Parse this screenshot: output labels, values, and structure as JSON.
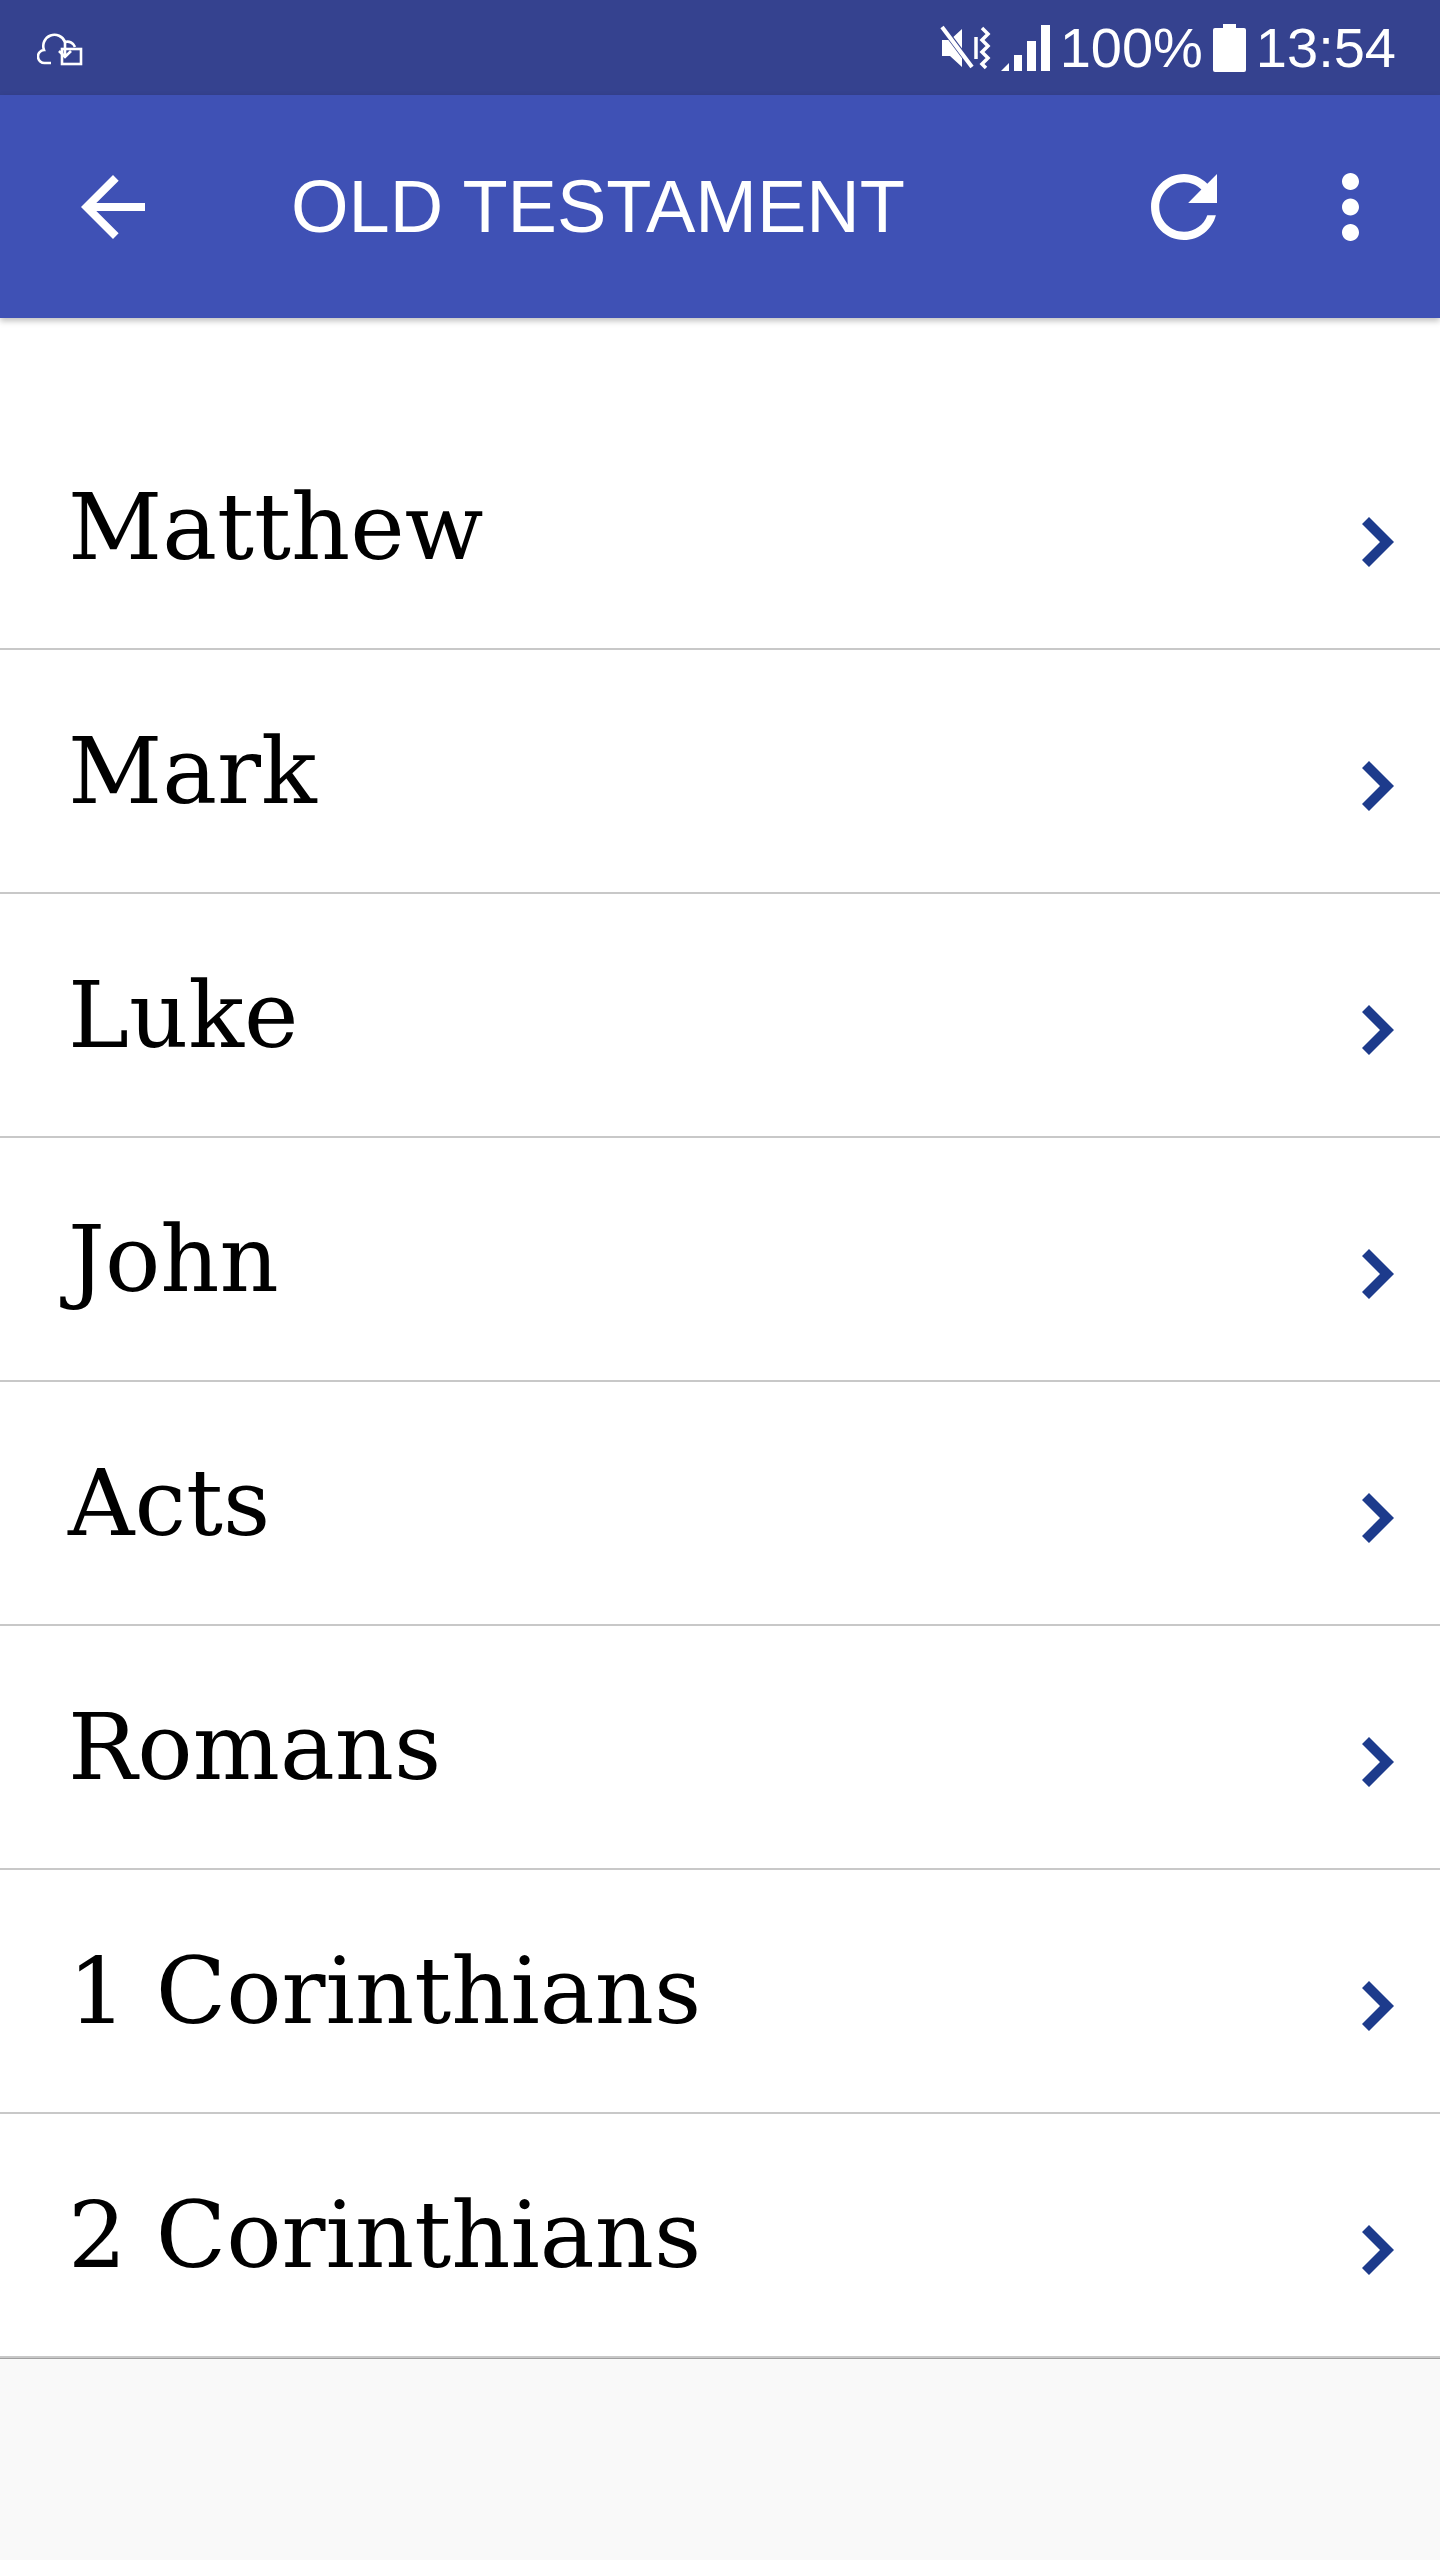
{
  "status_bar": {
    "battery": "100%",
    "time": "13:54"
  },
  "app_bar": {
    "title": "OLD TESTAMENT"
  },
  "books": [
    {
      "name": "Matthew"
    },
    {
      "name": "Mark"
    },
    {
      "name": "Luke"
    },
    {
      "name": "John"
    },
    {
      "name": "Acts"
    },
    {
      "name": "Romans"
    },
    {
      "name": "1 Corinthians"
    },
    {
      "name": "2 Corinthians"
    }
  ]
}
